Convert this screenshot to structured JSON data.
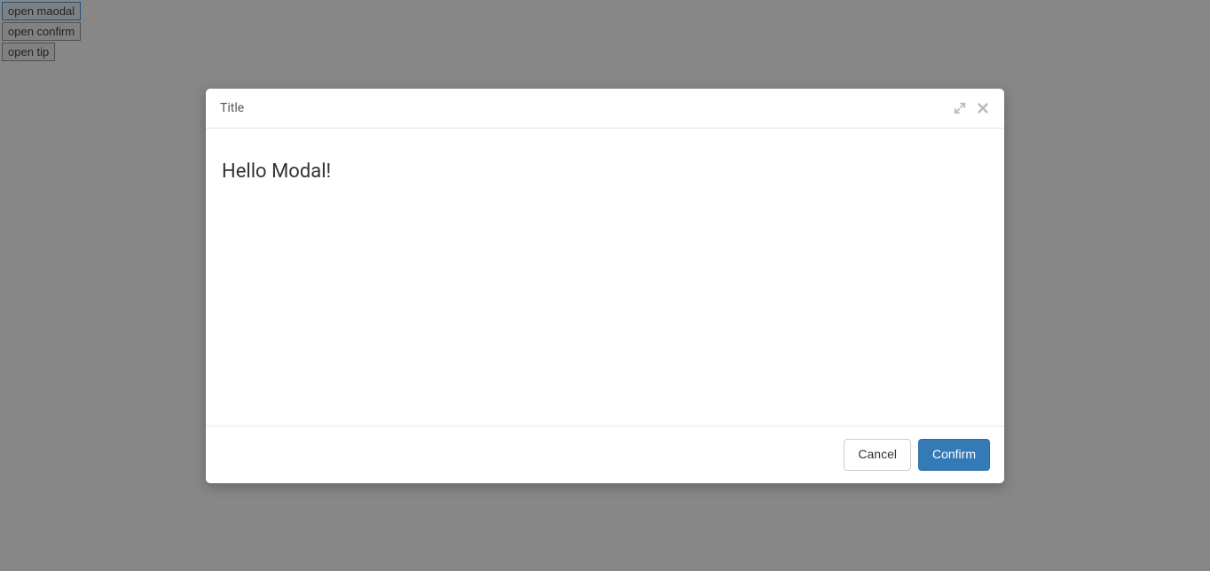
{
  "page": {
    "buttons": {
      "open_modal": "open maodal",
      "open_confirm": "open confirm",
      "open_tip": "open tip"
    }
  },
  "modal": {
    "title": "Title",
    "body_text": "Hello Modal!",
    "footer": {
      "cancel_label": "Cancel",
      "confirm_label": "Confirm"
    },
    "icons": {
      "expand": "expand-icon",
      "close": "close-icon"
    }
  }
}
